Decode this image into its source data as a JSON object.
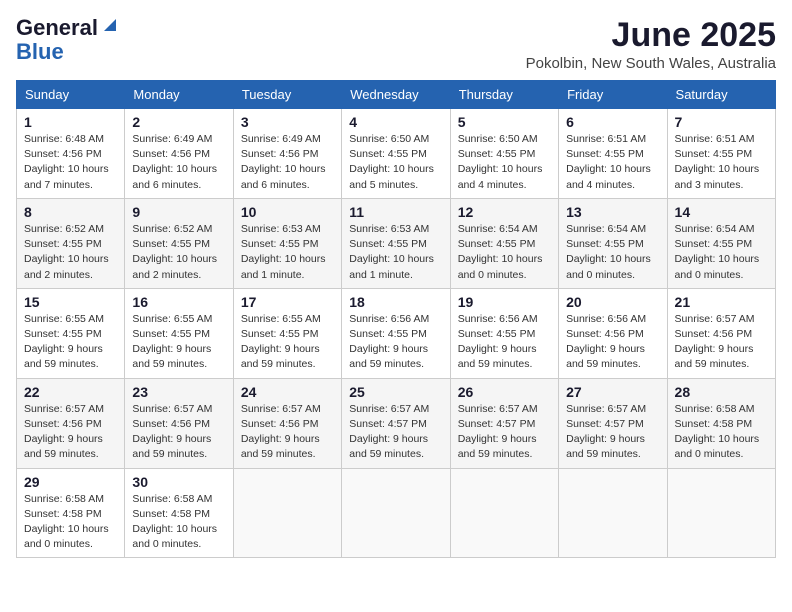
{
  "header": {
    "logo_general": "General",
    "logo_blue": "Blue",
    "month": "June 2025",
    "location": "Pokolbin, New South Wales, Australia"
  },
  "weekdays": [
    "Sunday",
    "Monday",
    "Tuesday",
    "Wednesday",
    "Thursday",
    "Friday",
    "Saturday"
  ],
  "weeks": [
    [
      {
        "day": "1",
        "sunrise": "6:48 AM",
        "sunset": "4:56 PM",
        "daylight": "10 hours and 7 minutes."
      },
      {
        "day": "2",
        "sunrise": "6:49 AM",
        "sunset": "4:56 PM",
        "daylight": "10 hours and 6 minutes."
      },
      {
        "day": "3",
        "sunrise": "6:49 AM",
        "sunset": "4:56 PM",
        "daylight": "10 hours and 6 minutes."
      },
      {
        "day": "4",
        "sunrise": "6:50 AM",
        "sunset": "4:55 PM",
        "daylight": "10 hours and 5 minutes."
      },
      {
        "day": "5",
        "sunrise": "6:50 AM",
        "sunset": "4:55 PM",
        "daylight": "10 hours and 4 minutes."
      },
      {
        "day": "6",
        "sunrise": "6:51 AM",
        "sunset": "4:55 PM",
        "daylight": "10 hours and 4 minutes."
      },
      {
        "day": "7",
        "sunrise": "6:51 AM",
        "sunset": "4:55 PM",
        "daylight": "10 hours and 3 minutes."
      }
    ],
    [
      {
        "day": "8",
        "sunrise": "6:52 AM",
        "sunset": "4:55 PM",
        "daylight": "10 hours and 2 minutes."
      },
      {
        "day": "9",
        "sunrise": "6:52 AM",
        "sunset": "4:55 PM",
        "daylight": "10 hours and 2 minutes."
      },
      {
        "day": "10",
        "sunrise": "6:53 AM",
        "sunset": "4:55 PM",
        "daylight": "10 hours and 1 minute."
      },
      {
        "day": "11",
        "sunrise": "6:53 AM",
        "sunset": "4:55 PM",
        "daylight": "10 hours and 1 minute."
      },
      {
        "day": "12",
        "sunrise": "6:54 AM",
        "sunset": "4:55 PM",
        "daylight": "10 hours and 0 minutes."
      },
      {
        "day": "13",
        "sunrise": "6:54 AM",
        "sunset": "4:55 PM",
        "daylight": "10 hours and 0 minutes."
      },
      {
        "day": "14",
        "sunrise": "6:54 AM",
        "sunset": "4:55 PM",
        "daylight": "10 hours and 0 minutes."
      }
    ],
    [
      {
        "day": "15",
        "sunrise": "6:55 AM",
        "sunset": "4:55 PM",
        "daylight": "9 hours and 59 minutes."
      },
      {
        "day": "16",
        "sunrise": "6:55 AM",
        "sunset": "4:55 PM",
        "daylight": "9 hours and 59 minutes."
      },
      {
        "day": "17",
        "sunrise": "6:55 AM",
        "sunset": "4:55 PM",
        "daylight": "9 hours and 59 minutes."
      },
      {
        "day": "18",
        "sunrise": "6:56 AM",
        "sunset": "4:55 PM",
        "daylight": "9 hours and 59 minutes."
      },
      {
        "day": "19",
        "sunrise": "6:56 AM",
        "sunset": "4:55 PM",
        "daylight": "9 hours and 59 minutes."
      },
      {
        "day": "20",
        "sunrise": "6:56 AM",
        "sunset": "4:56 PM",
        "daylight": "9 hours and 59 minutes."
      },
      {
        "day": "21",
        "sunrise": "6:57 AM",
        "sunset": "4:56 PM",
        "daylight": "9 hours and 59 minutes."
      }
    ],
    [
      {
        "day": "22",
        "sunrise": "6:57 AM",
        "sunset": "4:56 PM",
        "daylight": "9 hours and 59 minutes."
      },
      {
        "day": "23",
        "sunrise": "6:57 AM",
        "sunset": "4:56 PM",
        "daylight": "9 hours and 59 minutes."
      },
      {
        "day": "24",
        "sunrise": "6:57 AM",
        "sunset": "4:56 PM",
        "daylight": "9 hours and 59 minutes."
      },
      {
        "day": "25",
        "sunrise": "6:57 AM",
        "sunset": "4:57 PM",
        "daylight": "9 hours and 59 minutes."
      },
      {
        "day": "26",
        "sunrise": "6:57 AM",
        "sunset": "4:57 PM",
        "daylight": "9 hours and 59 minutes."
      },
      {
        "day": "27",
        "sunrise": "6:57 AM",
        "sunset": "4:57 PM",
        "daylight": "9 hours and 59 minutes."
      },
      {
        "day": "28",
        "sunrise": "6:58 AM",
        "sunset": "4:58 PM",
        "daylight": "10 hours and 0 minutes."
      }
    ],
    [
      {
        "day": "29",
        "sunrise": "6:58 AM",
        "sunset": "4:58 PM",
        "daylight": "10 hours and 0 minutes."
      },
      {
        "day": "30",
        "sunrise": "6:58 AM",
        "sunset": "4:58 PM",
        "daylight": "10 hours and 0 minutes."
      },
      null,
      null,
      null,
      null,
      null
    ]
  ]
}
